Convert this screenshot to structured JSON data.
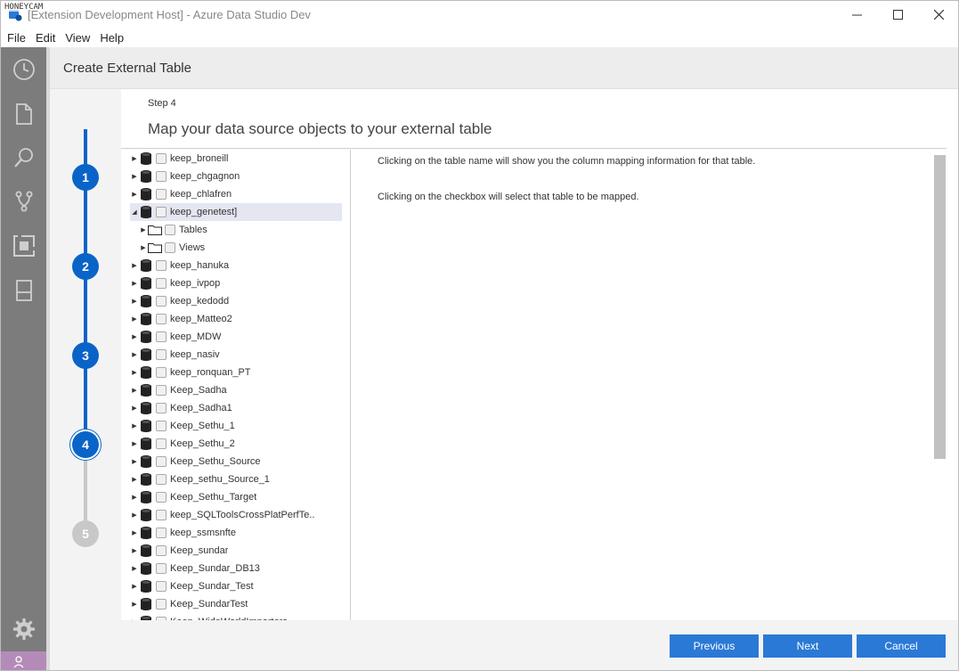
{
  "window": {
    "title": "[Extension Development Host] - Azure Data Studio Dev",
    "watermark": "HONEYCAM",
    "minimize_icon": "minimize-icon",
    "maximize_icon": "maximize-icon",
    "close_icon": "close-icon"
  },
  "menu": [
    "File",
    "Edit",
    "View",
    "Help"
  ],
  "activity_icons": [
    "history-icon",
    "file-icon",
    "search-icon",
    "source-control-icon",
    "extensions-icon",
    "notebook-icon",
    "gear-icon",
    "account-icon"
  ],
  "dialog": {
    "title": "Create External Table",
    "step_label": "Step 4",
    "heading": "Map your data source objects to your external table",
    "steps": [
      "1",
      "2",
      "3",
      "4",
      "5"
    ],
    "current_step": 4,
    "info_lines": [
      "Clicking on the table name will show you the column mapping information for that table.",
      "Clicking on the checkbox will select that table to be mapped."
    ],
    "tree": [
      {
        "label": "keep_broneill",
        "type": "db",
        "expanded": false,
        "selected": false,
        "indent": 0
      },
      {
        "label": "keep_chgagnon",
        "type": "db",
        "expanded": false,
        "selected": false,
        "indent": 0
      },
      {
        "label": "keep_chlafren",
        "type": "db",
        "expanded": false,
        "selected": false,
        "indent": 0
      },
      {
        "label": "keep_genetest]",
        "type": "db",
        "expanded": true,
        "selected": true,
        "indent": 0
      },
      {
        "label": "Tables",
        "type": "folder",
        "expanded": false,
        "selected": false,
        "indent": 1
      },
      {
        "label": "Views",
        "type": "folder",
        "expanded": false,
        "selected": false,
        "indent": 1
      },
      {
        "label": "keep_hanuka",
        "type": "db",
        "expanded": false,
        "selected": false,
        "indent": 0
      },
      {
        "label": "keep_ivpop",
        "type": "db",
        "expanded": false,
        "selected": false,
        "indent": 0
      },
      {
        "label": "keep_kedodd",
        "type": "db",
        "expanded": false,
        "selected": false,
        "indent": 0
      },
      {
        "label": "keep_Matteo2",
        "type": "db",
        "expanded": false,
        "selected": false,
        "indent": 0
      },
      {
        "label": "keep_MDW",
        "type": "db",
        "expanded": false,
        "selected": false,
        "indent": 0
      },
      {
        "label": "keep_nasiv",
        "type": "db",
        "expanded": false,
        "selected": false,
        "indent": 0
      },
      {
        "label": "keep_ronquan_PT",
        "type": "db",
        "expanded": false,
        "selected": false,
        "indent": 0
      },
      {
        "label": "Keep_Sadha",
        "type": "db",
        "expanded": false,
        "selected": false,
        "indent": 0
      },
      {
        "label": "Keep_Sadha1",
        "type": "db",
        "expanded": false,
        "selected": false,
        "indent": 0
      },
      {
        "label": "Keep_Sethu_1",
        "type": "db",
        "expanded": false,
        "selected": false,
        "indent": 0
      },
      {
        "label": "Keep_Sethu_2",
        "type": "db",
        "expanded": false,
        "selected": false,
        "indent": 0
      },
      {
        "label": "Keep_Sethu_Source",
        "type": "db",
        "expanded": false,
        "selected": false,
        "indent": 0
      },
      {
        "label": "Keep_sethu_Source_1",
        "type": "db",
        "expanded": false,
        "selected": false,
        "indent": 0
      },
      {
        "label": "Keep_Sethu_Target",
        "type": "db",
        "expanded": false,
        "selected": false,
        "indent": 0
      },
      {
        "label": "keep_SQLToolsCrossPlatPerfTe..",
        "type": "db",
        "expanded": false,
        "selected": false,
        "indent": 0
      },
      {
        "label": "keep_ssmsnfte",
        "type": "db",
        "expanded": false,
        "selected": false,
        "indent": 0
      },
      {
        "label": "Keep_sundar",
        "type": "db",
        "expanded": false,
        "selected": false,
        "indent": 0
      },
      {
        "label": "Keep_Sundar_DB13",
        "type": "db",
        "expanded": false,
        "selected": false,
        "indent": 0
      },
      {
        "label": "Keep_Sundar_Test",
        "type": "db",
        "expanded": false,
        "selected": false,
        "indent": 0
      },
      {
        "label": "Keep_SundarTest",
        "type": "db",
        "expanded": false,
        "selected": false,
        "indent": 0
      },
      {
        "label": "Keep_WideWorldImporters",
        "type": "db",
        "expanded": false,
        "selected": false,
        "indent": 0
      }
    ],
    "buttons": {
      "previous": "Previous",
      "next": "Next",
      "cancel": "Cancel"
    }
  },
  "colors": {
    "accent": "#0a64c8",
    "button": "#2b79d6",
    "activity_bar": "#7c7c7c",
    "selection": "#e4e6f1"
  }
}
